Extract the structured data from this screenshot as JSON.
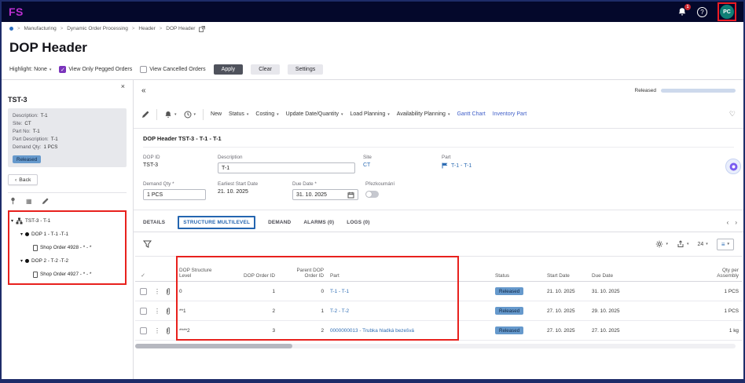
{
  "icons": {
    "caret_down": "▾",
    "kebab": "⋮",
    "check": "✓",
    "collapse": "«",
    "chevron_left": "‹",
    "chevron_right": "›",
    "close": "×",
    "breadcrumb_sep": ">",
    "question": "?",
    "list": "≡",
    "heart": "♡",
    "grid": "▦"
  },
  "topbar": {
    "logo": "FS",
    "bell_badge": "1",
    "avatar_initials": "PC"
  },
  "breadcrumb": {
    "items": [
      "Manufacturing",
      "Dynamic Order Processing",
      "Header",
      "DOP Header"
    ]
  },
  "page_title": "DOP Header",
  "filter_bar": {
    "highlight": "Highlight: None",
    "pegged": "View Only Pegged Orders",
    "cancelled": "View Cancelled Orders",
    "apply": "Apply",
    "clear": "Clear",
    "settings": "Settings"
  },
  "sidebar": {
    "title": "TST-3",
    "info": [
      {
        "label": "Description:",
        "value": "T-1"
      },
      {
        "label": "Site:",
        "value": "CT"
      },
      {
        "label": "Part No:",
        "value": "T-1"
      },
      {
        "label": "Part Description:",
        "value": "T-1"
      },
      {
        "label": "Demand Qty:",
        "value": "1 PCS"
      }
    ],
    "status": "Released",
    "back": "Back",
    "tree": [
      {
        "label": "TST-3 - T-1"
      },
      {
        "label": "DOP 1 - T-1 -T-1"
      },
      {
        "label": "Shop Order 4928 - * - *"
      },
      {
        "label": "DOP 2 - T-2 -T-2"
      },
      {
        "label": "Shop Order 4927 - * - *"
      }
    ]
  },
  "main": {
    "progress_label": "Released",
    "toolbar": {
      "new": "New",
      "status": "Status",
      "costing": "Costing",
      "update": "Update Date/Quantity",
      "load": "Load Planning",
      "availability": "Availability Planning",
      "gantt": "Gantt Chart",
      "inventory": "Inventory Part"
    },
    "card": {
      "title": "DOP Header TST-3 - T-1 - T-1",
      "dop_id_label": "DOP ID",
      "dop_id_value": "TST-3",
      "description_label": "Description",
      "description_value": "T-1",
      "site_label": "Site",
      "site_value": "CT",
      "part_label": "Part",
      "part_value": "T-1 - T-1",
      "demand_qty_label": "Demand Qty *",
      "demand_qty_value": "1 PCS",
      "earliest_label": "Earliest Start Date",
      "earliest_value": "21. 10. 2025",
      "due_label": "Due Date *",
      "due_value": "31. 10. 2025",
      "review_label": "Přezkoumání"
    },
    "tabs": {
      "details": "DETAILS",
      "structure": "STRUCTURE MULTILEVEL",
      "demand": "DEMAND",
      "alarms": "ALARMS (0)",
      "logs": "LOGS (0)"
    },
    "table": {
      "page_size": "24",
      "headers": {
        "level_l1": "DOP Structure",
        "level_l2": "Level",
        "order_id": "DOP Order ID",
        "parent_l1": "Parent DOP",
        "parent_l2": "Order ID",
        "part": "Part",
        "status": "Status",
        "start": "Start Date",
        "due": "Due Date",
        "qty_l1": "Qty per",
        "qty_l2": "Assembly"
      },
      "rows": [
        {
          "level": "0",
          "order_id": "1",
          "parent": "0",
          "part": "T-1 - T-1",
          "status": "Released",
          "start": "21. 10. 2025",
          "due": "31. 10. 2025",
          "qty": "1 PCS"
        },
        {
          "level": "**1",
          "order_id": "2",
          "parent": "1",
          "part": "T-2 - T-2",
          "status": "Released",
          "start": "27. 10. 2025",
          "due": "29. 10. 2025",
          "qty": "1 PCS"
        },
        {
          "level": "****2",
          "order_id": "3",
          "parent": "2",
          "part": "0000000013 - Trubka hladká bezešvá",
          "status": "Released",
          "start": "27. 10. 2025",
          "due": "27. 10. 2025",
          "qty": "1 kg"
        }
      ]
    }
  }
}
